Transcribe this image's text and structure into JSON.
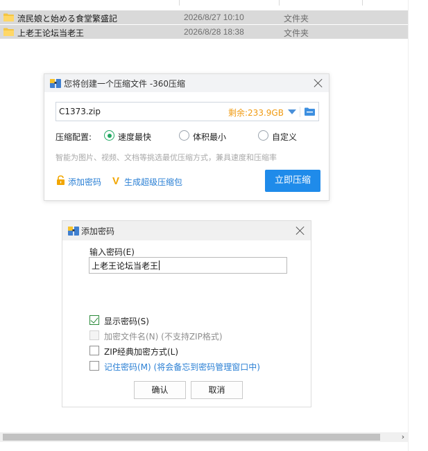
{
  "explorer": {
    "files": [
      {
        "name": "流民娘と始める食堂繁盛記",
        "date": "2026/8/27 10:10",
        "type": "文件夹"
      },
      {
        "name": "上老王论坛当老王",
        "date": "2026/8/28 18:38",
        "type": "文件夹"
      }
    ],
    "scroll_right_arrow": "›"
  },
  "compress_dialog": {
    "title": "您将创建一个压缩文件 -360压缩",
    "filename": "C1373.zip",
    "free_space": "剩余:233.9GB",
    "config_label": "压缩配置:",
    "options": [
      {
        "label": "速度最快",
        "selected": true
      },
      {
        "label": "体积最小",
        "selected": false
      },
      {
        "label": "自定义",
        "selected": false
      }
    ],
    "hint": "智能为图片、视频、文档等挑选最优压缩方式，兼具速度和压缩率",
    "add_password_link": "添加密码",
    "super_pack_link": "生成超级压缩包",
    "super_icon_letter": "V",
    "compress_button": "立即压缩",
    "accent_color": "#1f8bea"
  },
  "password_dialog": {
    "title": "添加密码",
    "input_label": "输入密码(E)",
    "input_value": "上老王论坛当老王",
    "checkboxes": [
      {
        "label": "显示密码(S)",
        "checked": true,
        "enabled": true
      },
      {
        "label": "加密文件名(N) (不支持ZIP格式)",
        "checked": false,
        "enabled": false
      },
      {
        "label": "ZIP经典加密方式(L)",
        "checked": false,
        "enabled": true
      },
      {
        "label": "记住密码(M) (将会备忘到密码管理窗口中)",
        "checked": false,
        "enabled": true
      }
    ],
    "ok_button": "确认",
    "cancel_button": "取消"
  }
}
